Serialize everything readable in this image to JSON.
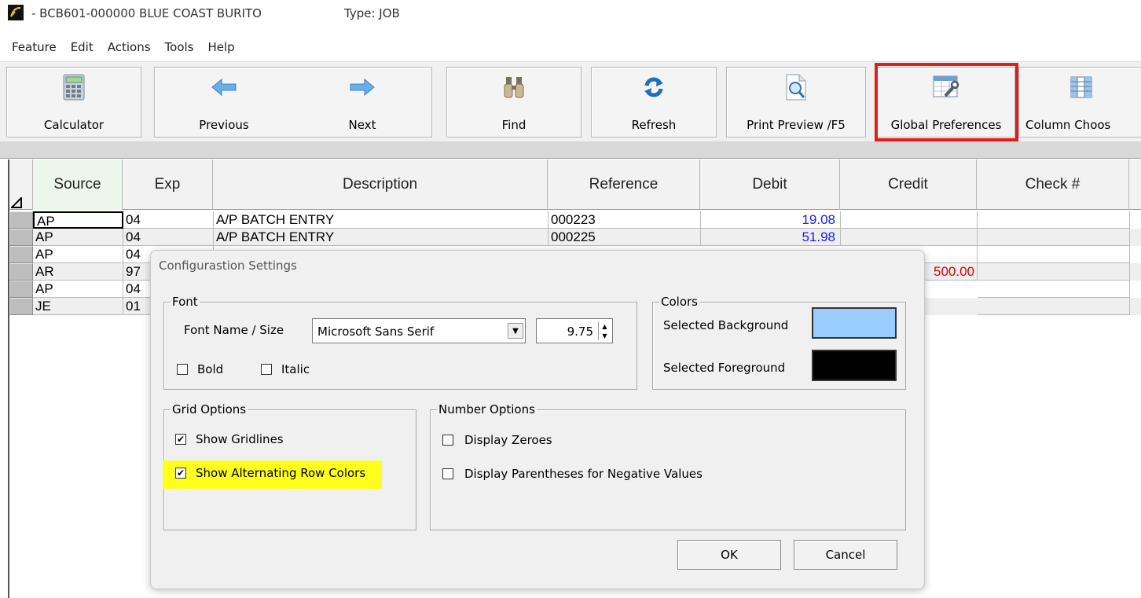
{
  "window": {
    "title": "- BCB601-000000  BLUE COAST BURITO",
    "type_label": "Type: JOB"
  },
  "menu": [
    "Feature",
    "Edit",
    "Actions",
    "Tools",
    "Help"
  ],
  "toolbar": {
    "calculator": "Calculator",
    "previous": "Previous",
    "next": "Next",
    "find": "Find",
    "refresh": "Refresh",
    "print_preview": "Print Preview /F5",
    "global_preferences": "Global Preferences",
    "column_chooser": "Column Choos"
  },
  "grid": {
    "columns": [
      "Source",
      "Exp",
      "Description",
      "Reference",
      "Debit",
      "Credit",
      "Check #"
    ],
    "rows": [
      {
        "source": "AP",
        "exp": "04",
        "description": "A/P BATCH ENTRY",
        "reference": "000223",
        "debit": "19.08",
        "credit": "",
        "check": ""
      },
      {
        "source": "AP",
        "exp": "04",
        "description": "A/P BATCH ENTRY",
        "reference": "000225",
        "debit": "51.98",
        "credit": "",
        "check": ""
      },
      {
        "source": "AP",
        "exp": "04",
        "description": "",
        "reference": "",
        "debit": "",
        "credit": "",
        "check": ""
      },
      {
        "source": "AR",
        "exp": "97",
        "description": "",
        "reference": "",
        "debit": "",
        "credit": "500.00",
        "check": ""
      },
      {
        "source": "AP",
        "exp": "04",
        "description": "",
        "reference": "",
        "debit": "",
        "credit": "",
        "check": ""
      },
      {
        "source": "JE",
        "exp": "01",
        "description": "",
        "reference": "",
        "debit": "",
        "credit": "",
        "check": ""
      }
    ]
  },
  "dialog": {
    "title": "Configurastion Settings",
    "font_group": "Font",
    "font_name_label": "Font Name / Size",
    "font_name_value": "Microsoft Sans Serif",
    "font_size_value": "9.75",
    "bold_label": "Bold",
    "italic_label": "Italic",
    "colors_group": "Colors",
    "selected_background_label": "Selected Background",
    "selected_foreground_label": "Selected Foreground",
    "selected_background_color": "#99ccff",
    "selected_foreground_color": "#000000",
    "grid_options_group": "Grid Options",
    "show_gridlines_label": "Show Gridlines",
    "show_alternating_label": "Show Alternating Row Colors",
    "number_options_group": "Number Options",
    "display_zeroes_label": "Display Zeroes",
    "display_parentheses_label": "Display Parentheses for Negative Values",
    "ok_label": "OK",
    "cancel_label": "Cancel",
    "checkbox_mark": "✔"
  },
  "colors": {
    "highlight_red": "#e21b1b",
    "highlight_yellow": "#ffff1e",
    "debit_blue": "#1a1aff",
    "credit_red": "#e00000"
  }
}
